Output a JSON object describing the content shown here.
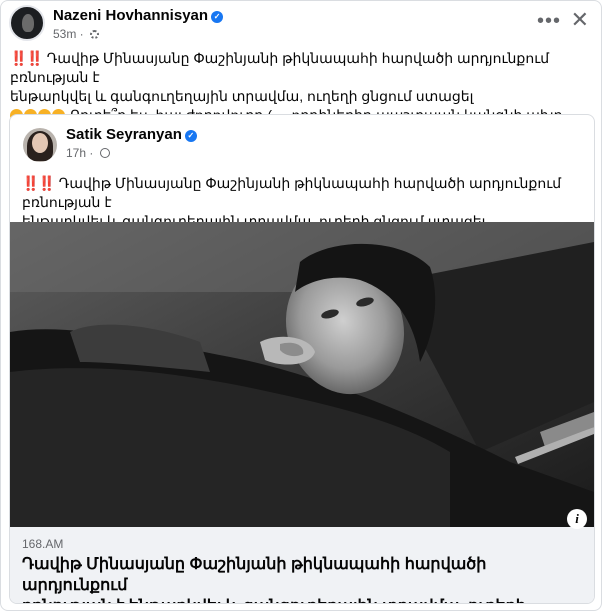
{
  "post": {
    "author": "Nazeni Hovhannisyan",
    "time": "53m",
    "more_label": "•••",
    "close_label": "✕",
    "line1_prefix": "‼️‼️",
    "line1": "Դավիթ Մինասյանը Փաշինյանի թիկնապահի հարվածի արդյունքում բռնության է",
    "line2": "ենթարկվել և գանգուղեղային տրավմա, ուղեղի ցնցում ստացել",
    "line3": "Որտե՞ղ ես, հայ ժողովուրդ (.... որդիներիդ պաշտպան կանգնի ախր....",
    "emojis": [
      "sad-face-emoji",
      "sad-face-emoji",
      "sad-face-emoji",
      "crying-face-emoji"
    ]
  },
  "shared": {
    "author": "Satik Seyranyan",
    "time": "17h",
    "text_prefix": "‼️‼️",
    "text_line1": "Դավիթ Մինասյանը Փաշինյանի թիկնապահի հարվածի արդյունքում բռնության է",
    "text_line2": "ենթարկվել և գանգուղեղային տրավմա, ուղեղի ցնցում ստացել",
    "link": {
      "domain": "168.AM",
      "headline_line1": "Դավիթ Մինասյանը Փաշինյանի թիկնապահի հարվածի արդյունքում",
      "headline_line2": "բռնության է ենթարկվել և գանգուղեղային տրավմա, ուղեղի ցնցում...",
      "info_label": "i"
    }
  },
  "colors": {
    "accent": "#1877f2",
    "muted": "#65676b",
    "link_bg": "#f0f2f5"
  }
}
